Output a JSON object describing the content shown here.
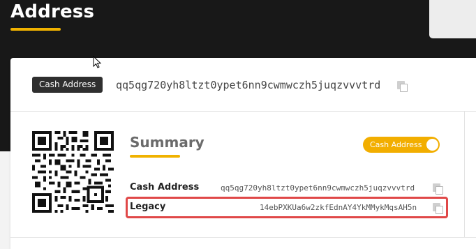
{
  "header": {
    "title": "Address"
  },
  "address_bar": {
    "badge": "Cash Address",
    "address": "qq5qg720yh8ltzt0ypet6nn9cwmwczh5juqzvvvtrd",
    "copy_icon": "copy-icon"
  },
  "summary": {
    "title": "Summary",
    "toggle": {
      "label": "Cash Address",
      "state": "on"
    },
    "rows": [
      {
        "label": "Cash Address",
        "value": "qq5qg720yh8ltzt0ypet6nn9cwmwczh5juqzvvvtrd"
      },
      {
        "label": "Legacy",
        "value": "14ebPXKUa6w2zkfEdnAY4YkMMykMqsAH5n"
      }
    ]
  },
  "colors": {
    "accent": "#f2ae00",
    "header_bg": "#181818",
    "highlight": "#e04848"
  }
}
